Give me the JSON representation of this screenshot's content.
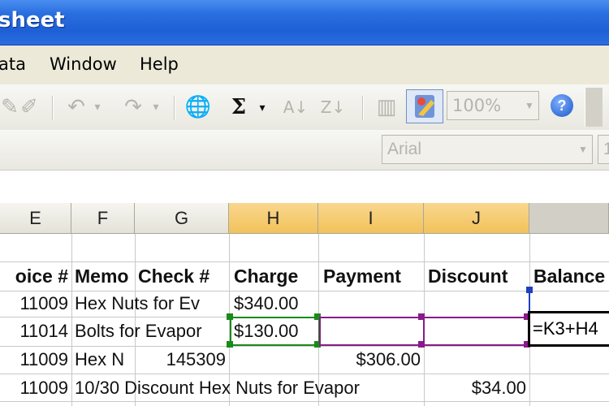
{
  "window": {
    "title": "sheet"
  },
  "menu": {
    "items": [
      "ata",
      "Window",
      "Help"
    ]
  },
  "toolbar": {
    "zoom_value": "100%",
    "font_name": "Arial",
    "font_size": "1",
    "help_label": "?"
  },
  "columns": [
    "E",
    "F",
    "G",
    "H",
    "I",
    "J"
  ],
  "header_row": {
    "E": "oice #",
    "F": "Memo",
    "G": "Check #",
    "H": "Charge",
    "I": "Payment",
    "J": "Discount",
    "K": "Balance"
  },
  "rows": [
    {
      "E": "11009",
      "F": "Hex Nuts for Ev",
      "G": "",
      "H": "$340.00",
      "I": "",
      "J": ""
    },
    {
      "E": "11014",
      "F": "Bolts for Evapor",
      "G": "",
      "H": "$130.00",
      "I": "",
      "J": ""
    },
    {
      "E": "11009",
      "F": "Hex N",
      "G": "145309",
      "H": "",
      "I": "$306.00",
      "J": ""
    },
    {
      "E": "11009",
      "F": "10/30 Discount Hex Nuts for Evapor",
      "G": "",
      "H": "",
      "I": "",
      "J": "$34.00"
    }
  ],
  "active_cell": {
    "formula": "=K3+H4"
  },
  "colors": {
    "titlebar": "#2a6fe0",
    "precedent_green": "#1a8a1a",
    "precedent_purple": "#8a1a8a",
    "active_header": "#f2c25a"
  }
}
